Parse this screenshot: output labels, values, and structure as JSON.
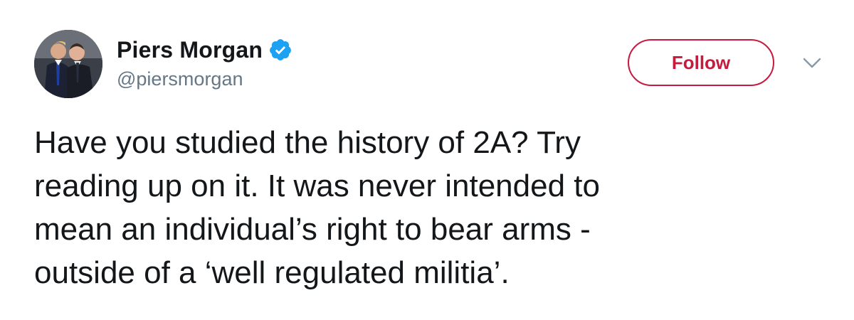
{
  "author": {
    "display_name": "Piers Morgan",
    "handle": "@piersmorgan",
    "verified": true,
    "avatar_icon": "profile-photo"
  },
  "actions": {
    "follow_label": "Follow",
    "more_icon": "chevron-down-icon"
  },
  "tweet": {
    "text": "Have you studied the history of 2A? Try\nreading up on it. It was never intended to\nmean an individual’s right to bear arms -\noutside of a ‘well regulated militia’."
  },
  "colors": {
    "follow_accent": "#c61a3e",
    "verified_badge": "#1da1f2",
    "handle_gray": "#657786",
    "text_dark": "#14171a"
  }
}
